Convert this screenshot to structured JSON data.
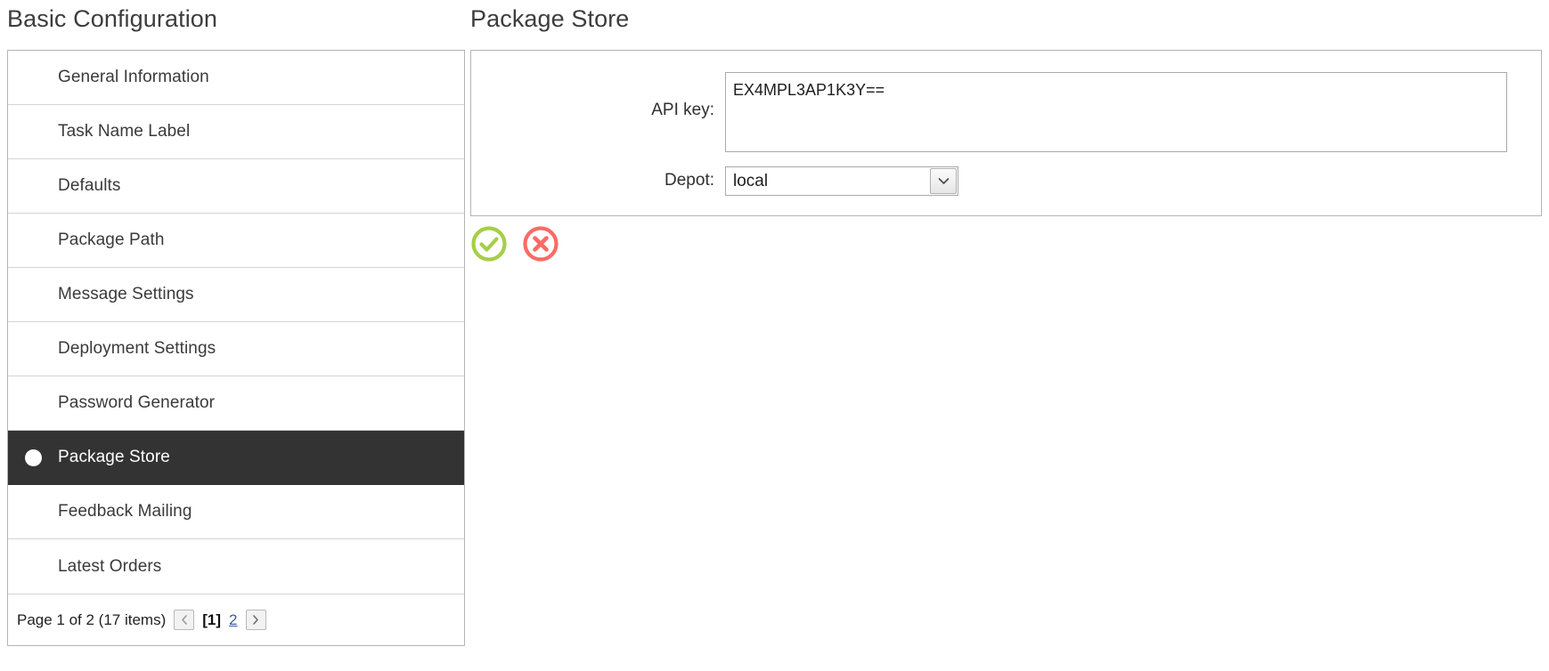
{
  "left_column": {
    "title": "Basic Configuration",
    "sidebar": {
      "items": [
        {
          "label": "General Information",
          "selected": false
        },
        {
          "label": "Task Name Label",
          "selected": false
        },
        {
          "label": "Defaults",
          "selected": false
        },
        {
          "label": "Package Path",
          "selected": false
        },
        {
          "label": "Message Settings",
          "selected": false
        },
        {
          "label": "Deployment Settings",
          "selected": false
        },
        {
          "label": "Password Generator",
          "selected": false
        },
        {
          "label": "Package Store",
          "selected": true
        },
        {
          "label": "Feedback Mailing",
          "selected": false
        },
        {
          "label": "Latest Orders",
          "selected": false
        }
      ]
    },
    "pager": {
      "summary": "Page 1 of 2 (17 items)",
      "prev_icon": "chevron-left-icon",
      "next_icon": "chevron-right-icon",
      "current_page": "[1]",
      "next_page_link": "2"
    }
  },
  "right_column": {
    "title": "Package Store",
    "form": {
      "api_key": {
        "label": "API key:",
        "value": "EX4MPL3AP1K3Y==",
        "placeholder": ""
      },
      "depot": {
        "label": "Depot:",
        "value": "local",
        "arrow_icon": "chevron-down-icon"
      }
    },
    "actions": {
      "save": {
        "name": "save-button",
        "icon": "check-circle-icon",
        "color": "#a6ce48"
      },
      "cancel": {
        "name": "cancel-button",
        "icon": "x-circle-icon",
        "color": "#fa6b66"
      }
    }
  },
  "colors": {
    "selected_row_bg": "#333333",
    "panel_border": "#b4b4b4",
    "row_divider": "#d4d4d4",
    "link": "#3c5a9a",
    "success": "#a6ce48",
    "danger": "#fa6b66"
  }
}
